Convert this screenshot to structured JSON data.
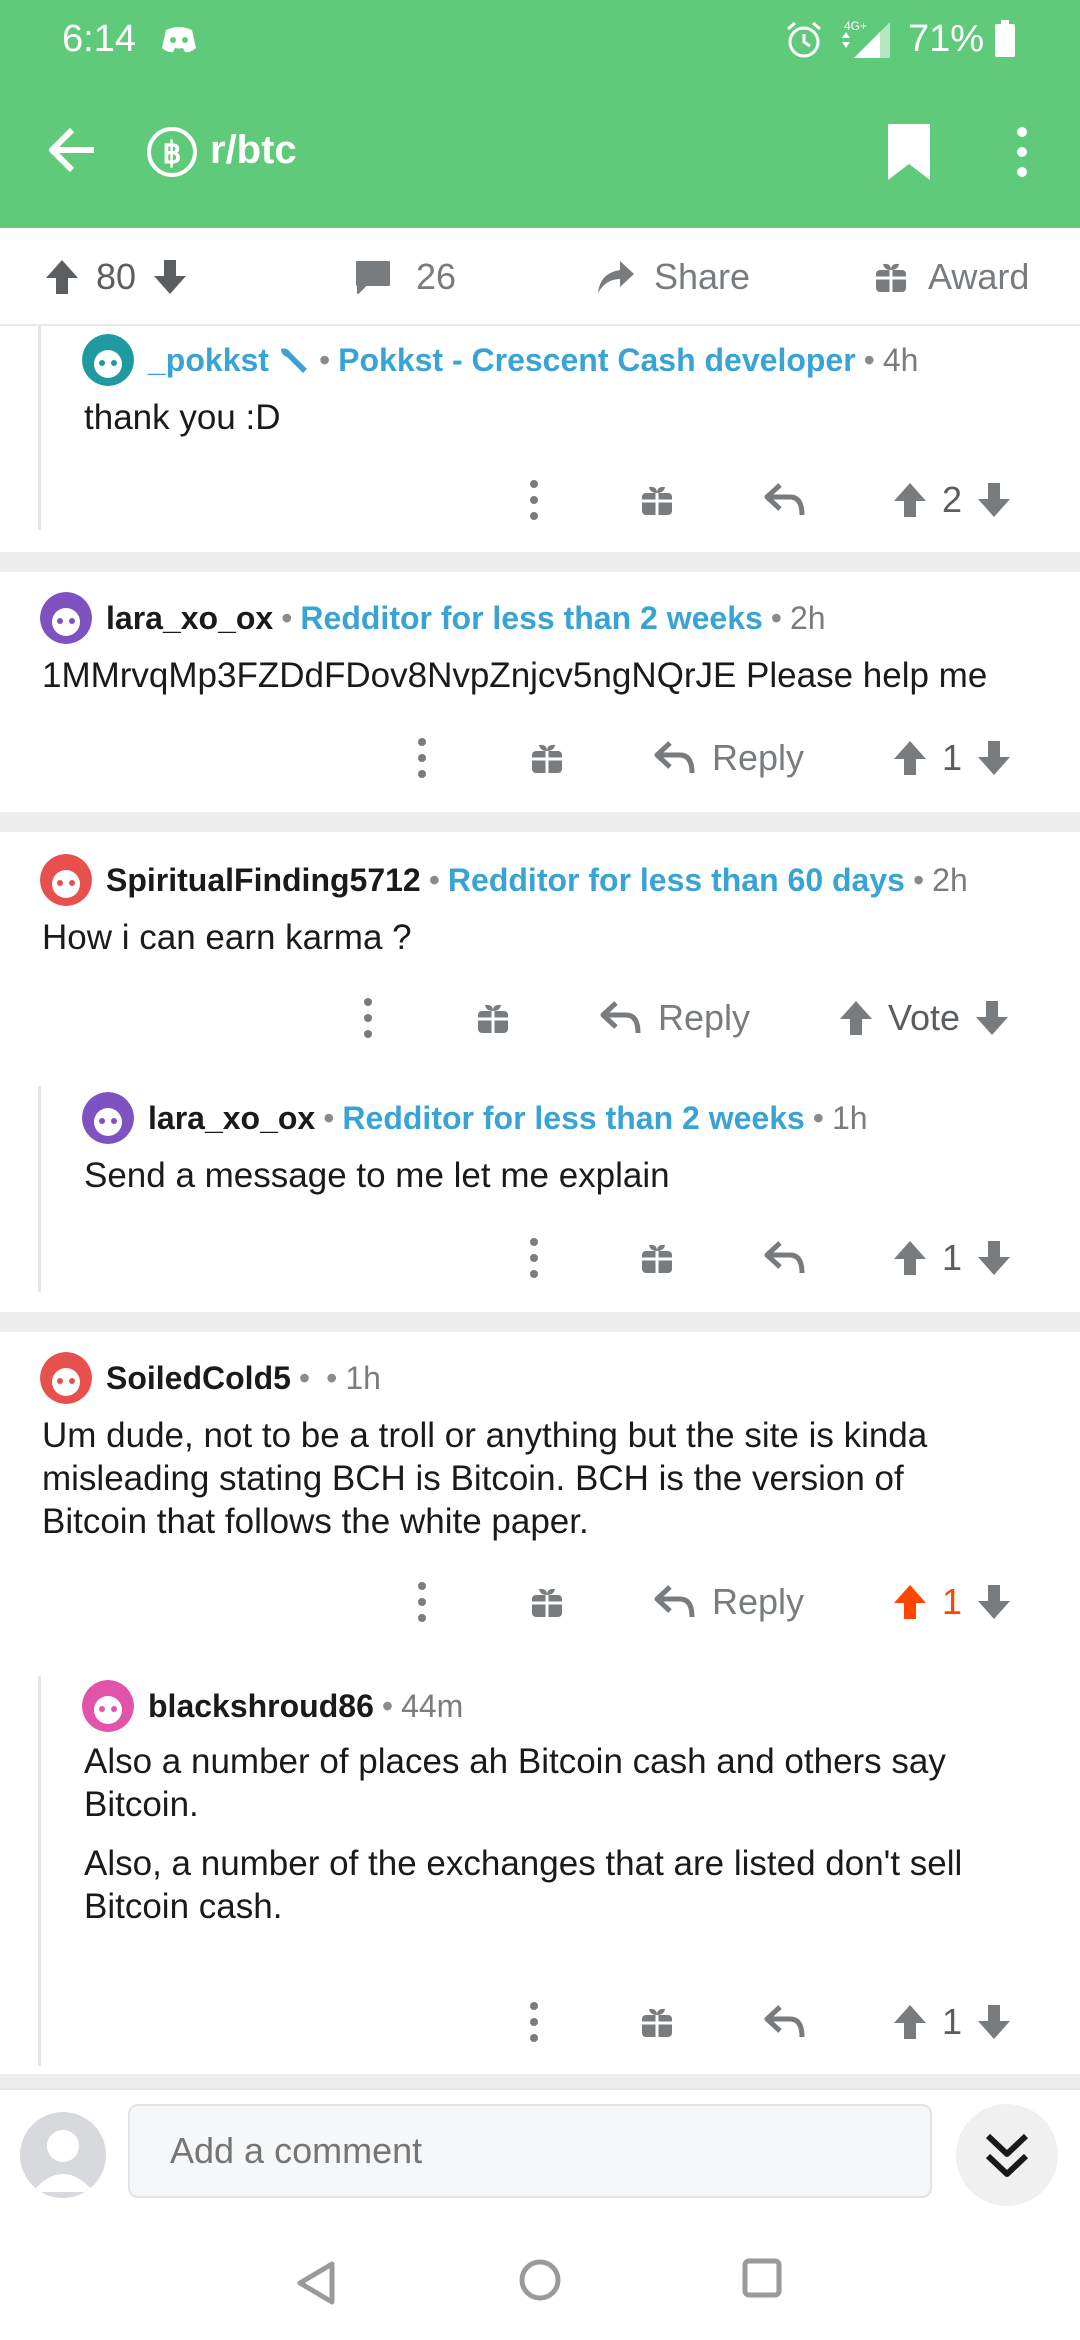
{
  "status": {
    "time": "6:14",
    "battery": "71%",
    "network": "4G+"
  },
  "header": {
    "subreddit": "r/btc"
  },
  "post_bar": {
    "votes": "80",
    "comments": "26",
    "share_label": "Share",
    "award_label": "Award"
  },
  "comments": [
    {
      "user": "_pokkst",
      "flair": "Pokkst - Crescent Cash developer",
      "age": "4h",
      "body": "thank you :D",
      "score": "2"
    },
    {
      "user": "lara_xo_ox",
      "flair": "Redditor for less than 2 weeks",
      "age": "2h",
      "body": "1MMrvqMp3FZDdFDov8NvpZnjcv5ngNQrJE Please  help me",
      "reply_label": "Reply",
      "score": "1"
    },
    {
      "user": "SpiritualFinding5712",
      "flair": "Redditor for less than 60 days",
      "age": "2h",
      "body": "How i can earn karma ?",
      "reply_label": "Reply",
      "score": "Vote"
    },
    {
      "user": "lara_xo_ox",
      "flair": "Redditor for less than 2 weeks",
      "age": "1h",
      "body": "Send a message to me let me explain",
      "score": "1"
    },
    {
      "user": "SoiledCold5",
      "flair": "",
      "age": "1h",
      "body": [
        "Um dude, not to be a troll or anything but the site is kinda",
        "misleading stating BCH is Bitcoin. BCH is the version of",
        "Bitcoin that follows the white paper."
      ],
      "reply_label": "Reply",
      "score": "1"
    },
    {
      "user": "blackshroud86",
      "age": "44m",
      "body": [
        "Also a number of places ah Bitcoin cash and others say",
        "Bitcoin.",
        "",
        "Also, a number of the exchanges that are listed don't sell",
        "Bitcoin cash."
      ],
      "score": "1"
    }
  ],
  "bottom": {
    "comment_placeholder": "Add a comment"
  },
  "colors": {
    "header_green": "#5fca79",
    "flair_blue": "#3aa3d6",
    "upvote_orange": "#ff4500"
  }
}
